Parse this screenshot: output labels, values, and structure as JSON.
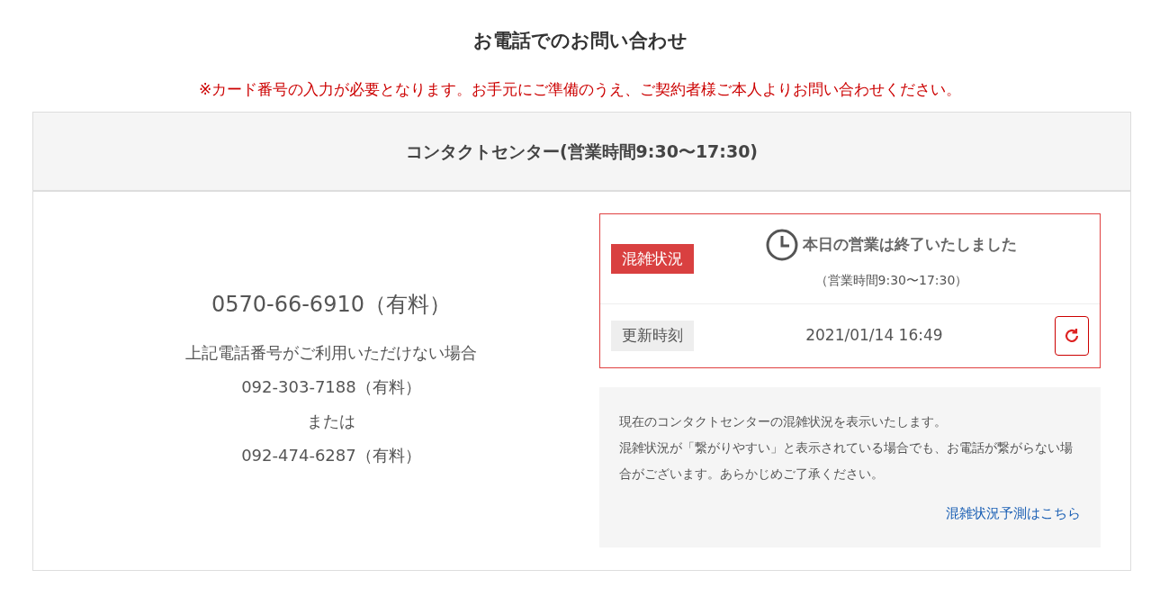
{
  "title": "お電話でのお問い合わせ",
  "notice": "※カード番号の入力が必要となります。お手元にご準備のうえ、ご契約者様ご本人よりお問い合わせください。",
  "card": {
    "header": "コンタクトセンター(営業時間9:30〜17:30)",
    "main_number": "0570-66-6910（有料）",
    "alternatives": [
      "上記電話番号がご利用いただけない場合",
      "092-303-7188（有料）",
      "または",
      "092-474-6287（有料）"
    ],
    "status": {
      "label": "混雑状況",
      "message": "本日の営業は終了いたしました",
      "hours": "（営業時間9:30〜17:30）"
    },
    "updated": {
      "label": "更新時刻",
      "time": "2021/01/14 16:49"
    },
    "info": {
      "lines": [
        "現在のコンタクトセンターの混雑状況を表示いたします。",
        "混雑状況が「繋がりやすい」と表示されている場合でも、お電話が繋がらない場合がございます。あらかじめご了承ください。"
      ],
      "link": "混雑状況予測はこちら"
    }
  }
}
